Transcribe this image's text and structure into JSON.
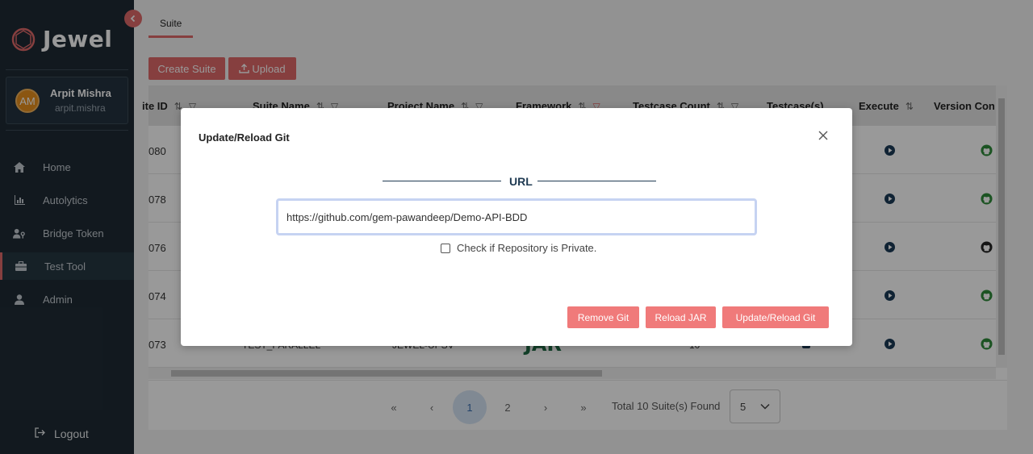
{
  "sidebar": {
    "brand": "Jewel",
    "user": {
      "initials": "AM",
      "name": "Arpit Mishra",
      "username": "arpit.mishra"
    },
    "items": [
      {
        "label": "Home",
        "icon": "home-icon"
      },
      {
        "label": "Autolytics",
        "icon": "chart-icon"
      },
      {
        "label": "Bridge Token",
        "icon": "users-key-icon"
      },
      {
        "label": "Test Tool",
        "icon": "toolbox-icon",
        "active": true
      },
      {
        "label": "Admin",
        "icon": "user-icon"
      }
    ],
    "logout": "Logout"
  },
  "main": {
    "tab": "Suite",
    "create_suite": "Create Suite",
    "upload": "Upload",
    "table": {
      "columns": [
        "ite ID",
        "Suite Name",
        "Project Name",
        "Framework",
        "Testcase Count",
        "Testcase(s)",
        "Execute",
        "Version Con"
      ],
      "rows": [
        {
          "id": "080"
        },
        {
          "id": "078"
        },
        {
          "id": "076"
        },
        {
          "id": "074"
        },
        {
          "id": "073",
          "suite_name": "TEST_PARALLEL",
          "project_name": "JEWEL-UPSV",
          "framework": "JAR",
          "testcase_count": "10"
        }
      ]
    },
    "pagination": {
      "first": "«",
      "prev": "‹",
      "pages": [
        "1",
        "2"
      ],
      "next": "›",
      "last": "»",
      "total": "Total 10 Suite(s) Found",
      "per_page": "5"
    }
  },
  "modal": {
    "title": "Update/Reload Git",
    "url_label": "URL",
    "url_value": "https://github.com/gem-pawandeep/Demo-API-BDD",
    "private_label": "Check if Repository is Private.",
    "buttons": {
      "remove": "Remove Git",
      "reload_jar": "Reload JAR",
      "update": "Update/Reload Git"
    }
  },
  "colors": {
    "accent": "#e06a6a",
    "sidebar": "#1f2b35",
    "navy": "#1f3a52"
  }
}
